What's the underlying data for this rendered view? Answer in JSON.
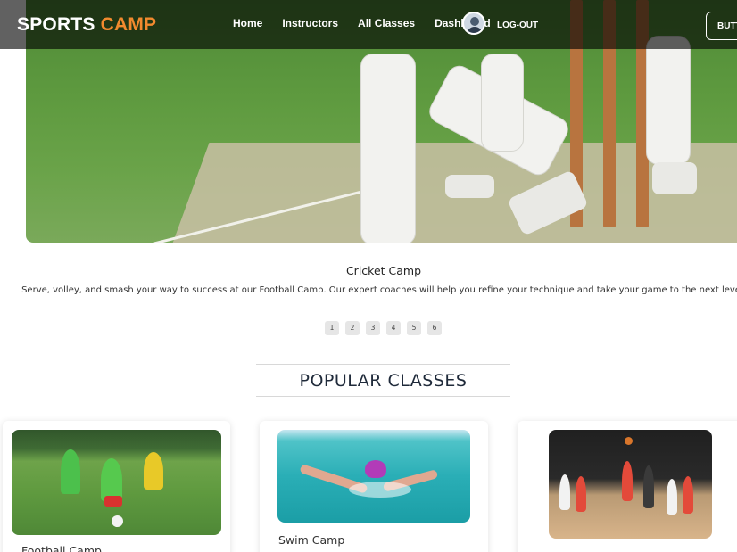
{
  "brand": {
    "name_part1": "SPORTS",
    "name_part2": "CAMP",
    "accent_color": "#f28a2e"
  },
  "nav": {
    "links": [
      "Home",
      "Instructors",
      "All Classes",
      "Dashboard"
    ],
    "avatar_icon": "user-avatar-icon",
    "logout_label": "LOG-OUT",
    "button_label": "BUTTON"
  },
  "hero": {
    "caption_title": "Cricket Camp",
    "caption_text": "Serve, volley, and smash your way to success at our Football Camp. Our expert coaches will help you refine your technique and take your game to the next level.",
    "pagination": [
      "1",
      "2",
      "3",
      "4",
      "5",
      "6"
    ]
  },
  "popular": {
    "heading": "POPULAR CLASSES",
    "cards": [
      {
        "title": "Football Camp"
      },
      {
        "title": "Swim Camp"
      },
      {
        "title": ""
      }
    ]
  }
}
